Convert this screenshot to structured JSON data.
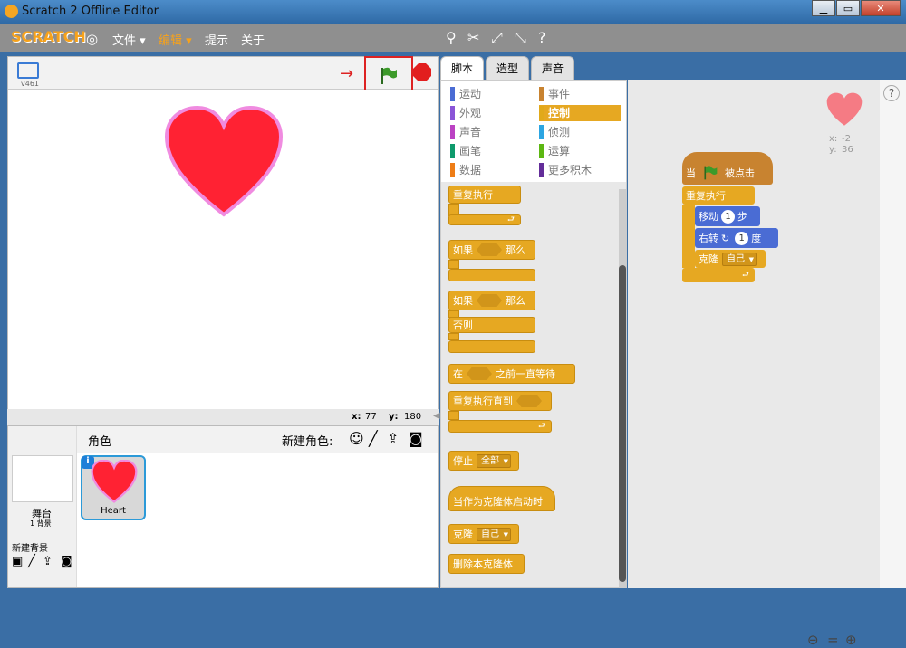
{
  "window": {
    "title": "Scratch 2 Offline Editor"
  },
  "menu": {
    "logo": "SCRATCH",
    "file": "文件 ▾",
    "edit": "编辑 ▾",
    "tips": "提示",
    "about": "关于"
  },
  "stage": {
    "version": "v461",
    "mouse_x_label": "x:",
    "mouse_x": "77",
    "mouse_y_label": "y:",
    "mouse_y": "180"
  },
  "sprites": {
    "header": "角色",
    "new_sprite": "新建角色:",
    "stage_label": "舞台",
    "stage_bg_count": "1 背景",
    "new_backdrop": "新建背景",
    "items": [
      {
        "name": "Heart"
      }
    ]
  },
  "tabs": [
    {
      "label": "脚本"
    },
    {
      "label": "造型"
    },
    {
      "label": "声音"
    }
  ],
  "categories": [
    {
      "label": "运动",
      "color": "#4a6cd4"
    },
    {
      "label": "事件",
      "color": "#c88330"
    },
    {
      "label": "外观",
      "color": "#8a55d7"
    },
    {
      "label": "控制",
      "color": "#e1a91a"
    },
    {
      "label": "声音",
      "color": "#bb42c3"
    },
    {
      "label": "侦测",
      "color": "#2ca5e2"
    },
    {
      "label": "画笔",
      "color": "#0e9a6c"
    },
    {
      "label": "运算",
      "color": "#5cb712"
    },
    {
      "label": "数据",
      "color": "#ee7d16"
    },
    {
      "label": "更多积木",
      "color": "#632d99"
    }
  ],
  "palette_blocks": {
    "forever": "重复执行",
    "if": "如果",
    "then": "那么",
    "else": "否则",
    "wait_until_pre": "在",
    "wait_until_post": "之前一直等待",
    "repeat_until": "重复执行直到",
    "stop": "停止",
    "stop_opt": "全部",
    "when_clone": "当作为克隆体启动时",
    "clone": "克隆",
    "clone_opt": "自己",
    "delete_clone": "删除本克隆体"
  },
  "script": {
    "hat_pre": "当",
    "hat_post": "被点击",
    "forever": "重复执行",
    "move_pre": "移动",
    "move_val": "1",
    "move_post": "步",
    "turn_pre": "右转",
    "turn_val": "1",
    "turn_post": "度",
    "clone": "克隆",
    "clone_opt": "自己"
  },
  "sprite_info": {
    "x_label": "x:",
    "x": "-2",
    "y_label": "y:",
    "y": "36"
  }
}
